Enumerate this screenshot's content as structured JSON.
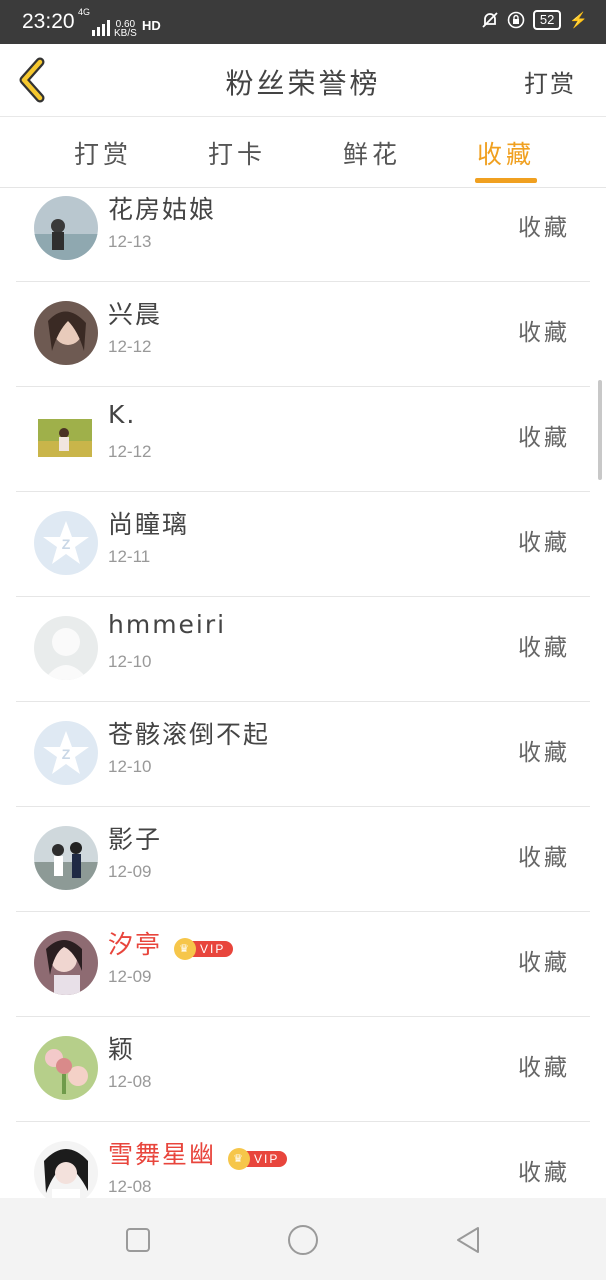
{
  "status_bar": {
    "time": "23:20",
    "net_type": "4G",
    "speed_value": "0.60",
    "speed_unit": "KB/S",
    "hd": "HD",
    "battery": "52"
  },
  "header": {
    "title": "粉丝荣誉榜",
    "action_label": "打赏"
  },
  "tabs": [
    {
      "label": "打赏",
      "active": false
    },
    {
      "label": "打卡",
      "active": false
    },
    {
      "label": "鲜花",
      "active": false
    },
    {
      "label": "收藏",
      "active": true
    }
  ],
  "rows": [
    {
      "name": "花房姑娘",
      "date": "12-13",
      "action": "收藏",
      "vip": false,
      "avatar_style": "photo-sea"
    },
    {
      "name": "兴晨",
      "date": "12-12",
      "action": "收藏",
      "vip": false,
      "avatar_style": "photo-girl"
    },
    {
      "name": "K.",
      "date": "12-12",
      "action": "收藏",
      "vip": false,
      "avatar_style": "photo-field"
    },
    {
      "name": "尚瞳璃",
      "date": "12-11",
      "action": "收藏",
      "vip": false,
      "avatar_style": "default-qq"
    },
    {
      "name": "hmmeiri",
      "date": "12-10",
      "action": "收藏",
      "vip": false,
      "avatar_style": "default-blank"
    },
    {
      "name": "苍骸滚倒不起",
      "date": "12-10",
      "action": "收藏",
      "vip": false,
      "avatar_style": "default-qq"
    },
    {
      "name": "影子",
      "date": "12-09",
      "action": "收藏",
      "vip": false,
      "avatar_style": "photo-couple"
    },
    {
      "name": "汐亭",
      "date": "12-09",
      "action": "收藏",
      "vip": true,
      "vip_label": "VIP",
      "avatar_style": "photo-girl2"
    },
    {
      "name": "颖",
      "date": "12-08",
      "action": "收藏",
      "vip": false,
      "avatar_style": "photo-flower"
    },
    {
      "name": "雪舞星幽",
      "date": "12-08",
      "action": "收藏",
      "vip": true,
      "vip_label": "VIP",
      "avatar_style": "photo-girl3"
    }
  ],
  "colors": {
    "accent": "#f0a020",
    "vip_name": "#e8453c",
    "status_bar": "#3b3b3b"
  },
  "icons": {
    "back": "chevron-left-icon",
    "nav": [
      "square-icon",
      "circle-icon",
      "triangle-left-icon"
    ]
  }
}
